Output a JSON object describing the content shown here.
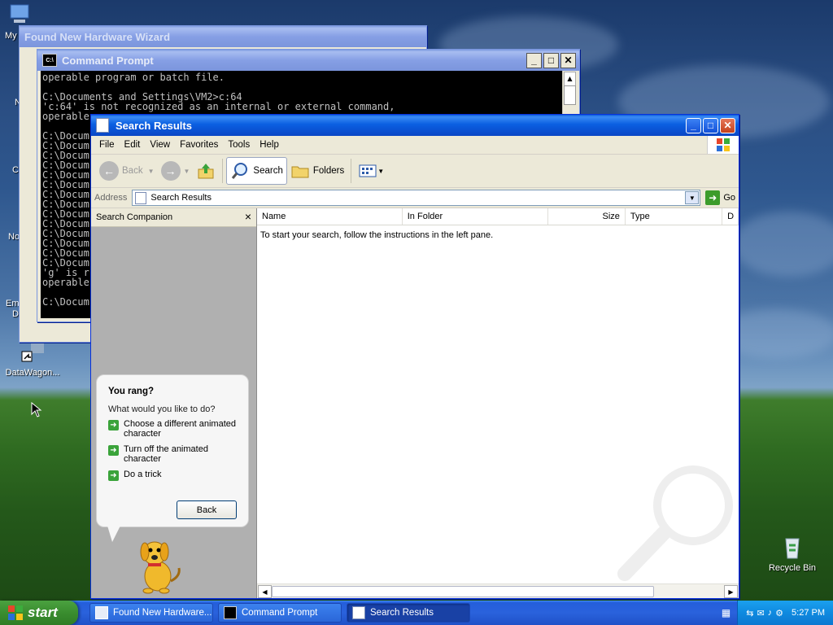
{
  "desktop": {
    "icons": [
      {
        "label": "My"
      },
      {
        "label": "DataWagon..."
      },
      {
        "label": "Recycle Bin"
      }
    ],
    "fragments": [
      "N",
      "C",
      "No",
      "Em",
      "D"
    ]
  },
  "wizard": {
    "title": "Found New Hardware Wizard"
  },
  "cmd": {
    "title": "Command Prompt",
    "lines": [
      "operable program or batch file.",
      "",
      "C:\\Documents and Settings\\VM2>c:64",
      "'c:64' is not recognized as an internal or external command,",
      "operable",
      "",
      "C:\\Docum",
      "C:\\Docum",
      "C:\\Docum",
      "C:\\Docum",
      "C:\\Docum",
      "C:\\Docum",
      "C:\\Docum",
      "C:\\Docum",
      "C:\\Docum",
      "C:\\Docum",
      "C:\\Docum",
      "C:\\Docum",
      "C:\\Docum",
      "C:\\Docum",
      "'g' is r",
      "operable",
      "",
      "C:\\Docum"
    ]
  },
  "explorer": {
    "title": "Search Results",
    "menu": [
      "File",
      "Edit",
      "View",
      "Favorites",
      "Tools",
      "Help"
    ],
    "toolbar": {
      "back": "Back",
      "search": "Search",
      "folders": "Folders"
    },
    "address": {
      "label": "Address",
      "value": "Search Results",
      "go": "Go"
    },
    "companion": {
      "title": "Search Companion",
      "close": "×"
    },
    "bubble": {
      "heading": "You rang?",
      "question": "What would you like to do?",
      "options": [
        "Choose a different animated character",
        "Turn off the animated character",
        "Do a trick"
      ],
      "back": "Back"
    },
    "columns": [
      "Name",
      "In Folder",
      "Size",
      "Type",
      "D"
    ],
    "empty_message": "To start your search, follow the instructions in the left pane."
  },
  "taskbar": {
    "start": "start",
    "tasks": [
      "Found New Hardware...",
      "Command Prompt",
      "Search Results"
    ],
    "clock": "5:27 PM"
  }
}
